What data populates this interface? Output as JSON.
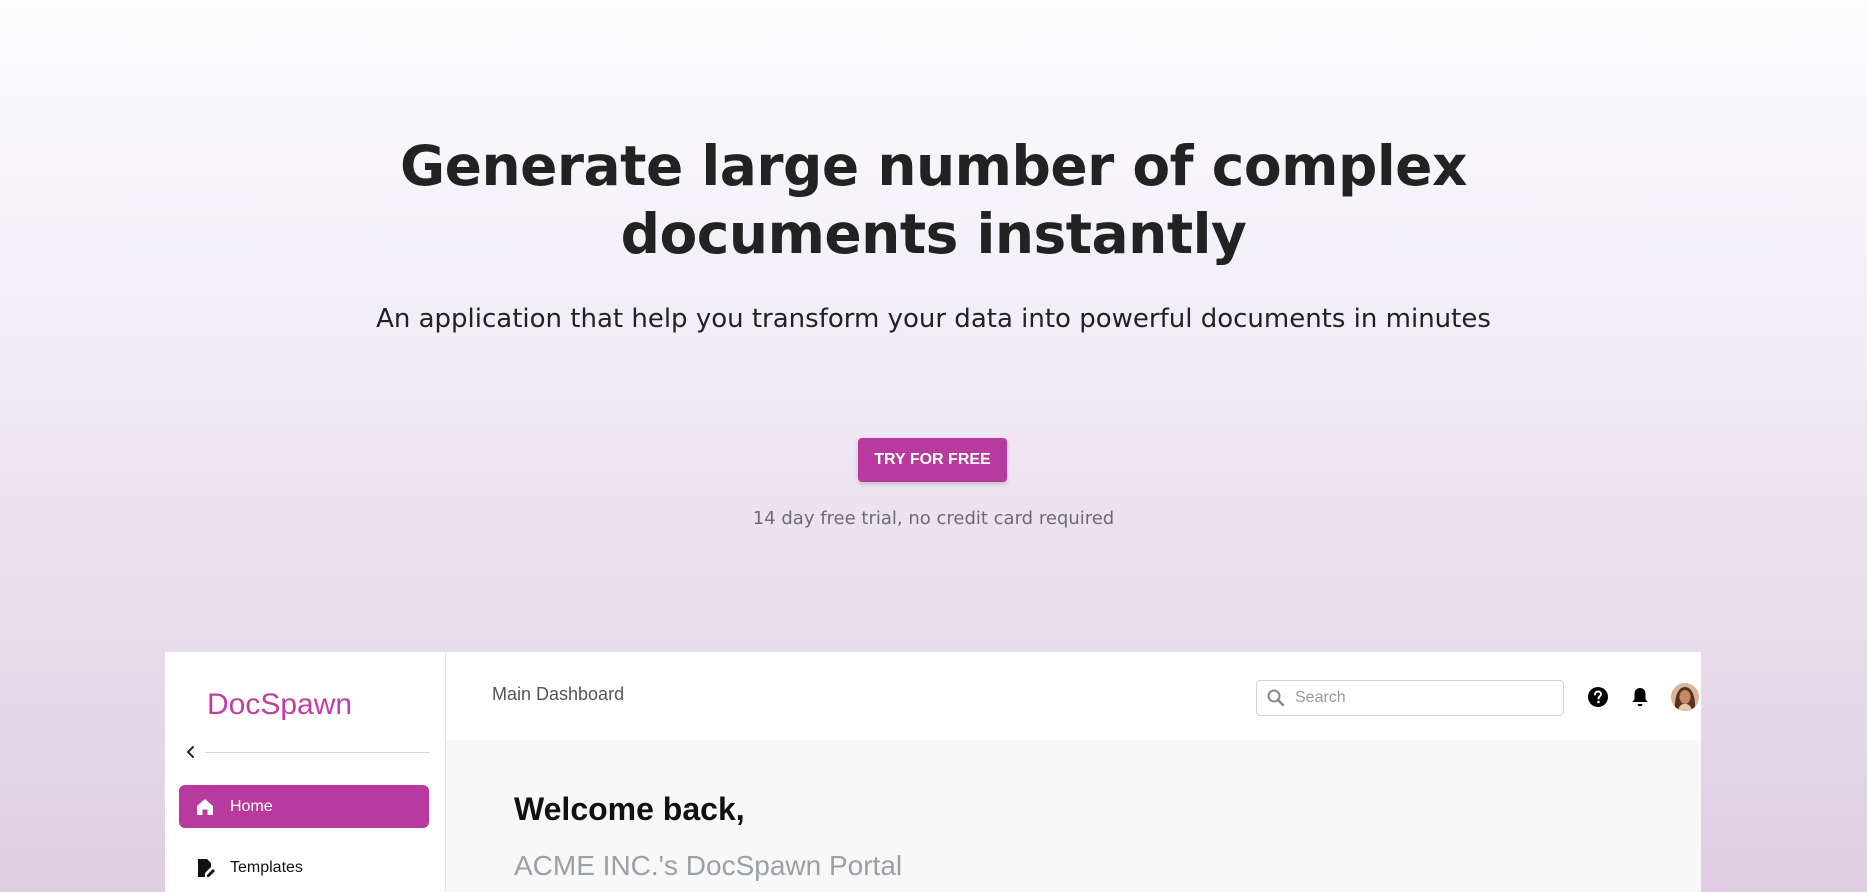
{
  "hero": {
    "title_line1": "Generate large number of complex",
    "title_line2": "documents instantly",
    "subtitle": "An application that help you transform your data into powerful documents in minutes",
    "cta_label": "TRY FOR FREE",
    "trial_note": "14 day free trial, no credit card required"
  },
  "app": {
    "logo": "DocSpawn",
    "sidebar": {
      "items": [
        {
          "label": "Home",
          "icon": "home-icon",
          "active": true
        },
        {
          "label": "Templates",
          "icon": "template-edit-icon",
          "active": false
        }
      ]
    },
    "topbar": {
      "title": "Main Dashboard",
      "search_placeholder": "Search",
      "icons": [
        "help-icon",
        "bell-icon",
        "avatar"
      ]
    },
    "content": {
      "welcome": "Welcome back,",
      "portal": "ACME INC.'s DocSpawn Portal"
    }
  },
  "colors": {
    "accent": "#b93a9e",
    "logo": "#c13fa4",
    "heading": "#222222",
    "muted": "#6d6a75"
  }
}
